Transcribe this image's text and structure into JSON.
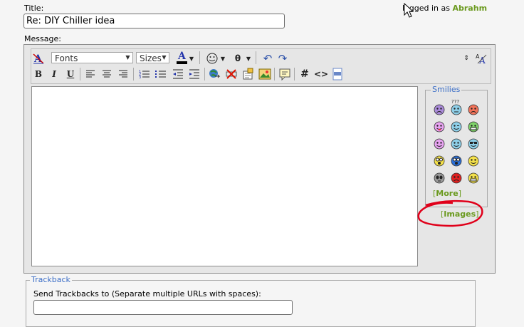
{
  "form": {
    "title_label": "Title:",
    "title_value": "Re: DIY Chiller idea",
    "message_label": "Message:",
    "logged_prefix": "logged in as",
    "username": "Abrahm"
  },
  "toolbar": {
    "fonts_label": "Fonts",
    "sizes_label": "Sizes",
    "bold": "B",
    "italic": "I",
    "underline": "U",
    "hash": "#",
    "code": "<>"
  },
  "smilies": {
    "legend": "Smilies",
    "more_open": "[",
    "more_label": "More",
    "more_close": "]",
    "qqq": "???"
  },
  "images": {
    "open": "[",
    "label": "Images",
    "close": "]"
  },
  "trackback": {
    "legend": "Trackback",
    "instructions": "Send Trackbacks to (Separate multiple URLs with spaces):",
    "value": ""
  },
  "colors": {
    "accent_green": "#6b9a1f",
    "legend_blue": "#3d6fc7",
    "annotation_red": "#e0001a"
  }
}
